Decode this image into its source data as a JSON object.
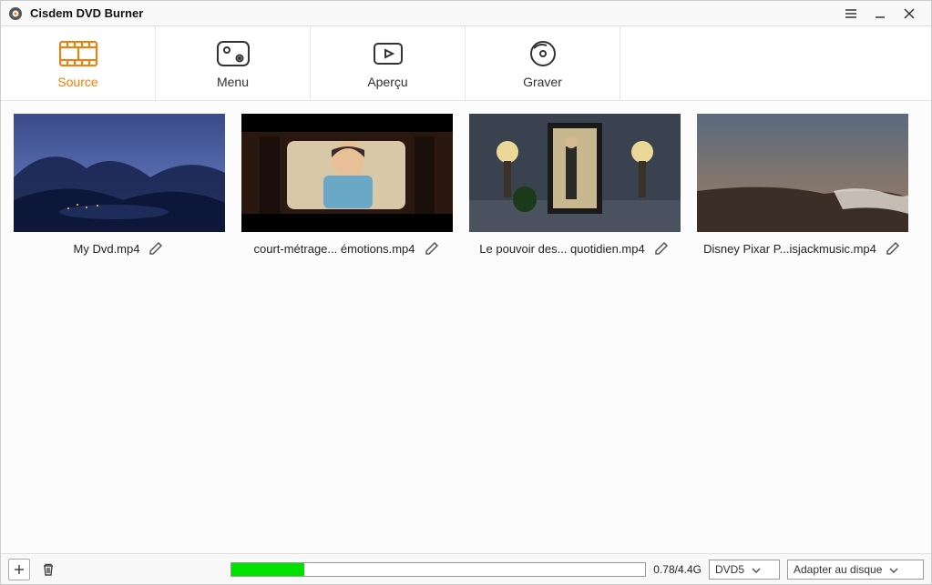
{
  "app": {
    "title": "Cisdem DVD Burner"
  },
  "tabs": [
    {
      "id": "source",
      "label": "Source",
      "active": true
    },
    {
      "id": "menu",
      "label": "Menu",
      "active": false
    },
    {
      "id": "preview",
      "label": "Aperçu",
      "active": false
    },
    {
      "id": "burn",
      "label": "Graver",
      "active": false
    }
  ],
  "videos": [
    {
      "filename": "My Dvd.mp4"
    },
    {
      "filename": "court-métrage... émotions.mp4"
    },
    {
      "filename": "Le pouvoir des... quotidien.mp4"
    },
    {
      "filename": "Disney Pixar  P...isjackmusic.mp4"
    }
  ],
  "status": {
    "used_label": "0.78/4.4G",
    "used_gb": 0.78,
    "capacity_gb": 4.4,
    "fill_percent": 17.7,
    "disc_type": "DVD5",
    "fit_mode": "Adapter au disque"
  },
  "colors": {
    "accent": "#ff7b00",
    "progress": "#00e100"
  }
}
